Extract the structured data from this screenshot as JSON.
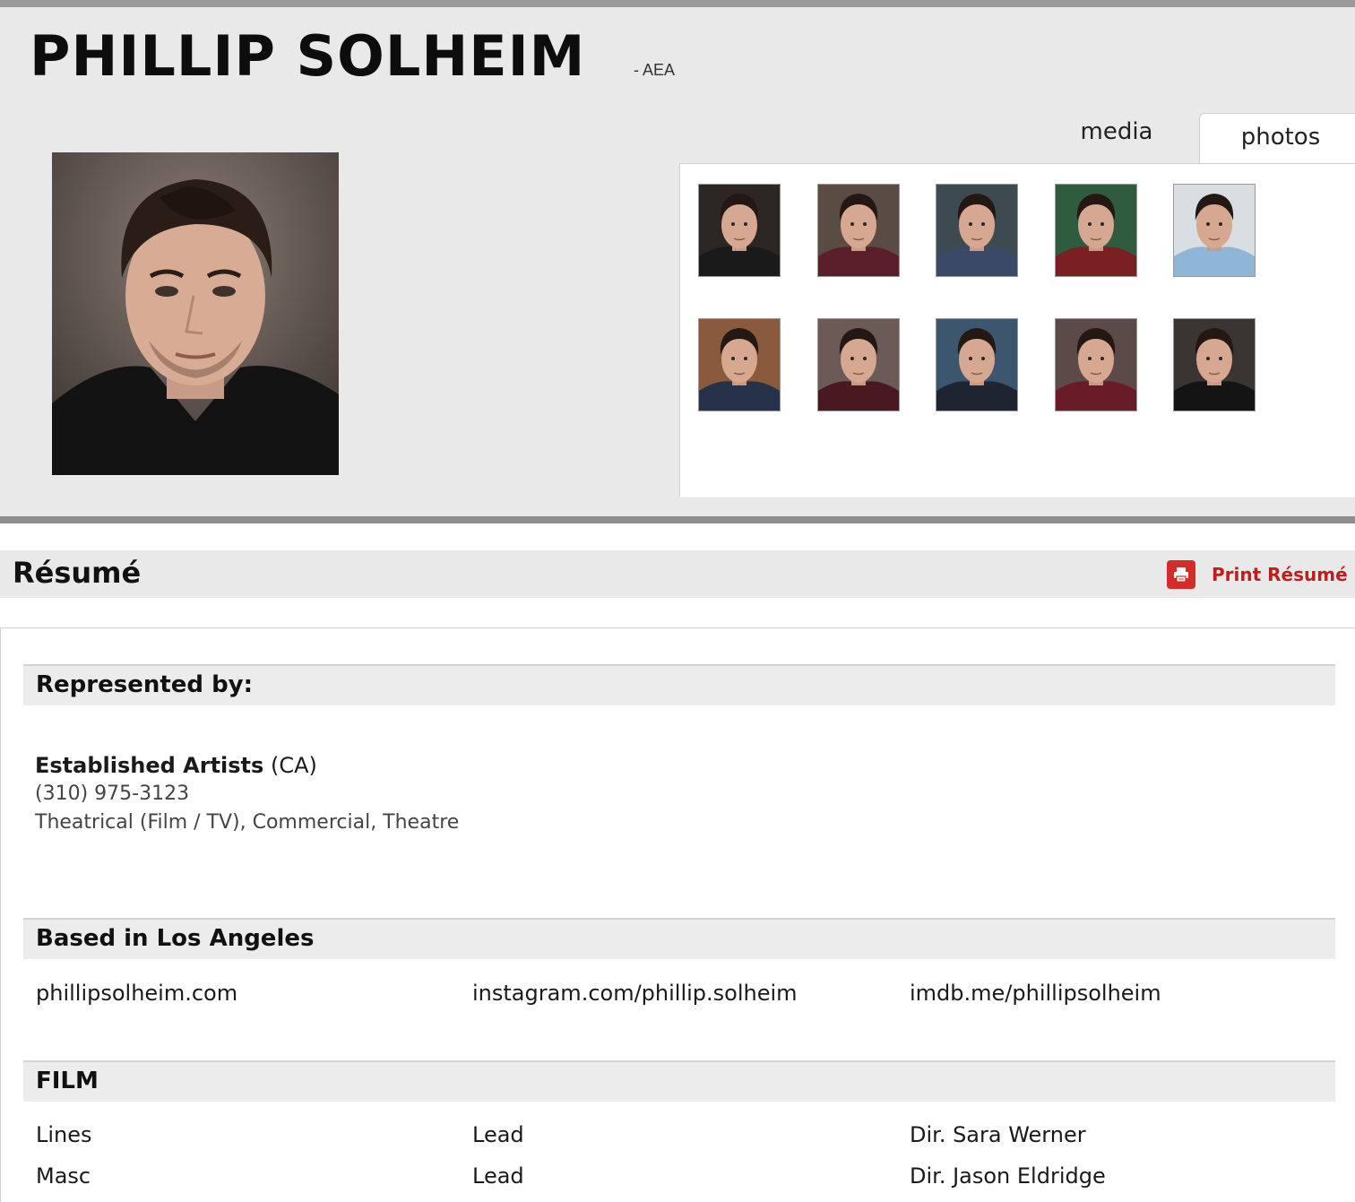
{
  "actor": {
    "name": "PHILLIP SOLHEIM",
    "union": "- AEA"
  },
  "tabs": [
    {
      "label": "media",
      "active": false
    },
    {
      "label": "photos",
      "active": true
    }
  ],
  "gallery": {
    "thumbnail_count": 10
  },
  "resume": {
    "title": "Résumé",
    "print_label": "Print Résumé",
    "print_icon": "printer-icon",
    "representation": {
      "heading": "Represented by:",
      "agency": "Established Artists",
      "region": "(CA)",
      "phone": "(310) 975-3123",
      "departments": "Theatrical (Film / TV), Commercial, Theatre"
    },
    "location": {
      "heading": "Based in Los Angeles",
      "links": [
        "phillipsolheim.com",
        "instagram.com/phillip.solheim",
        "imdb.me/phillipsolheim"
      ]
    },
    "film": {
      "heading": "FILM",
      "rows": [
        {
          "title": "Lines",
          "role": "Lead",
          "director": "Dir. Sara Werner"
        },
        {
          "title": "Masc",
          "role": "Lead",
          "director": "Dir. Jason Eldridge"
        }
      ]
    }
  },
  "colors": {
    "header_bg": "#e9e9e9",
    "accent_red": "#c21d1d"
  }
}
